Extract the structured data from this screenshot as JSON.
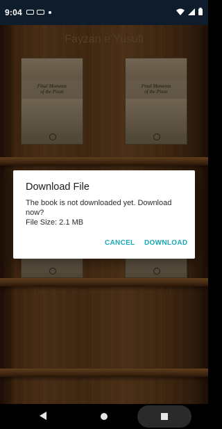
{
  "status_bar": {
    "time": "9:04",
    "icons": [
      "message-icon",
      "message-icon",
      "notification-dot-icon",
      "wifi-icon",
      "signal-icon",
      "battery-icon"
    ]
  },
  "app": {
    "title": "Fayzan e Yusufi",
    "books": [
      {
        "cover_title": "Final Moments\nof the Pious"
      },
      {
        "cover_title": "Final Moments\nof the Pious"
      }
    ]
  },
  "dialog": {
    "title": "Download File",
    "message": "The book is not downloaded yet. Download now?",
    "file_size": "File Size: 2.1 MB",
    "cancel_label": "CANCEL",
    "download_label": "DOWNLOAD",
    "accent_color": "#19a9b8"
  },
  "nav_bar": {
    "icons": [
      "back-icon",
      "home-icon",
      "recents-icon"
    ]
  }
}
